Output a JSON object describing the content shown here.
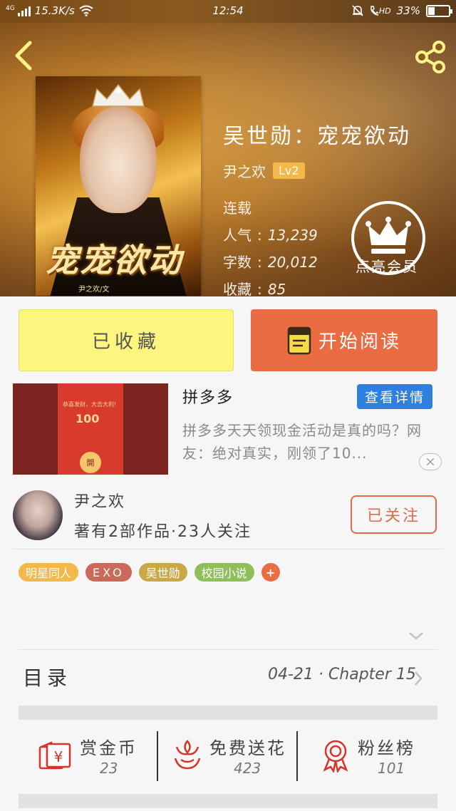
{
  "status_bar": {
    "network": "4G",
    "speed": "15.3K/s",
    "time": "12:54",
    "hd": "HD",
    "battery": "33%",
    "battery_level": 0.33
  },
  "book": {
    "title": "吴世勋：宠宠欲动",
    "author": "尹之欢",
    "level": "Lv2",
    "status": "连载",
    "stats": [
      {
        "label": "人气",
        "value": "13,239"
      },
      {
        "label": "字数",
        "value": "20,012"
      },
      {
        "label": "收藏",
        "value": "85"
      }
    ],
    "member_label": "点亮会员",
    "cover": {
      "title": "宠宠欲动",
      "credit": "尹之欢/文"
    }
  },
  "actions": {
    "collected_label": "已收藏",
    "read_label": "开始阅读"
  },
  "ad": {
    "title": "拼多多",
    "detail_button": "查看详情",
    "description": "拼多多天天领现金活动是真的吗？网友：绝对真实，刚领了10...",
    "envelope_text": "恭喜发财，大吉大利!",
    "envelope_amount": "100",
    "envelope_open": "開"
  },
  "author": {
    "name": "尹之欢",
    "meta": "著有2部作品·23人关注",
    "follow_label": "已关注"
  },
  "tags": [
    {
      "label": "明星同人",
      "color": "#f3b84a"
    },
    {
      "label": "EXO",
      "color": "#c96a5a"
    },
    {
      "label": "吴世勋",
      "color": "#caa84a"
    },
    {
      "label": "校园小说",
      "color": "#8fbf5a"
    },
    {
      "label": "+",
      "color": "#ea6c43"
    }
  ],
  "toc": {
    "label": "目录",
    "latest": "04-21 · Chapter 15"
  },
  "bottom_actions": [
    {
      "label": "赏金币",
      "count": "23",
      "icon": "money-envelope-icon"
    },
    {
      "label": "免费送花",
      "count": "423",
      "icon": "flower-icon"
    },
    {
      "label": "粉丝榜",
      "count": "101",
      "icon": "medal-icon"
    }
  ],
  "colors": {
    "accent": "#ea6c43",
    "collected_bg": "#fcf57e",
    "detail_button": "#2f7fde",
    "icon_red": "#d9322a"
  }
}
